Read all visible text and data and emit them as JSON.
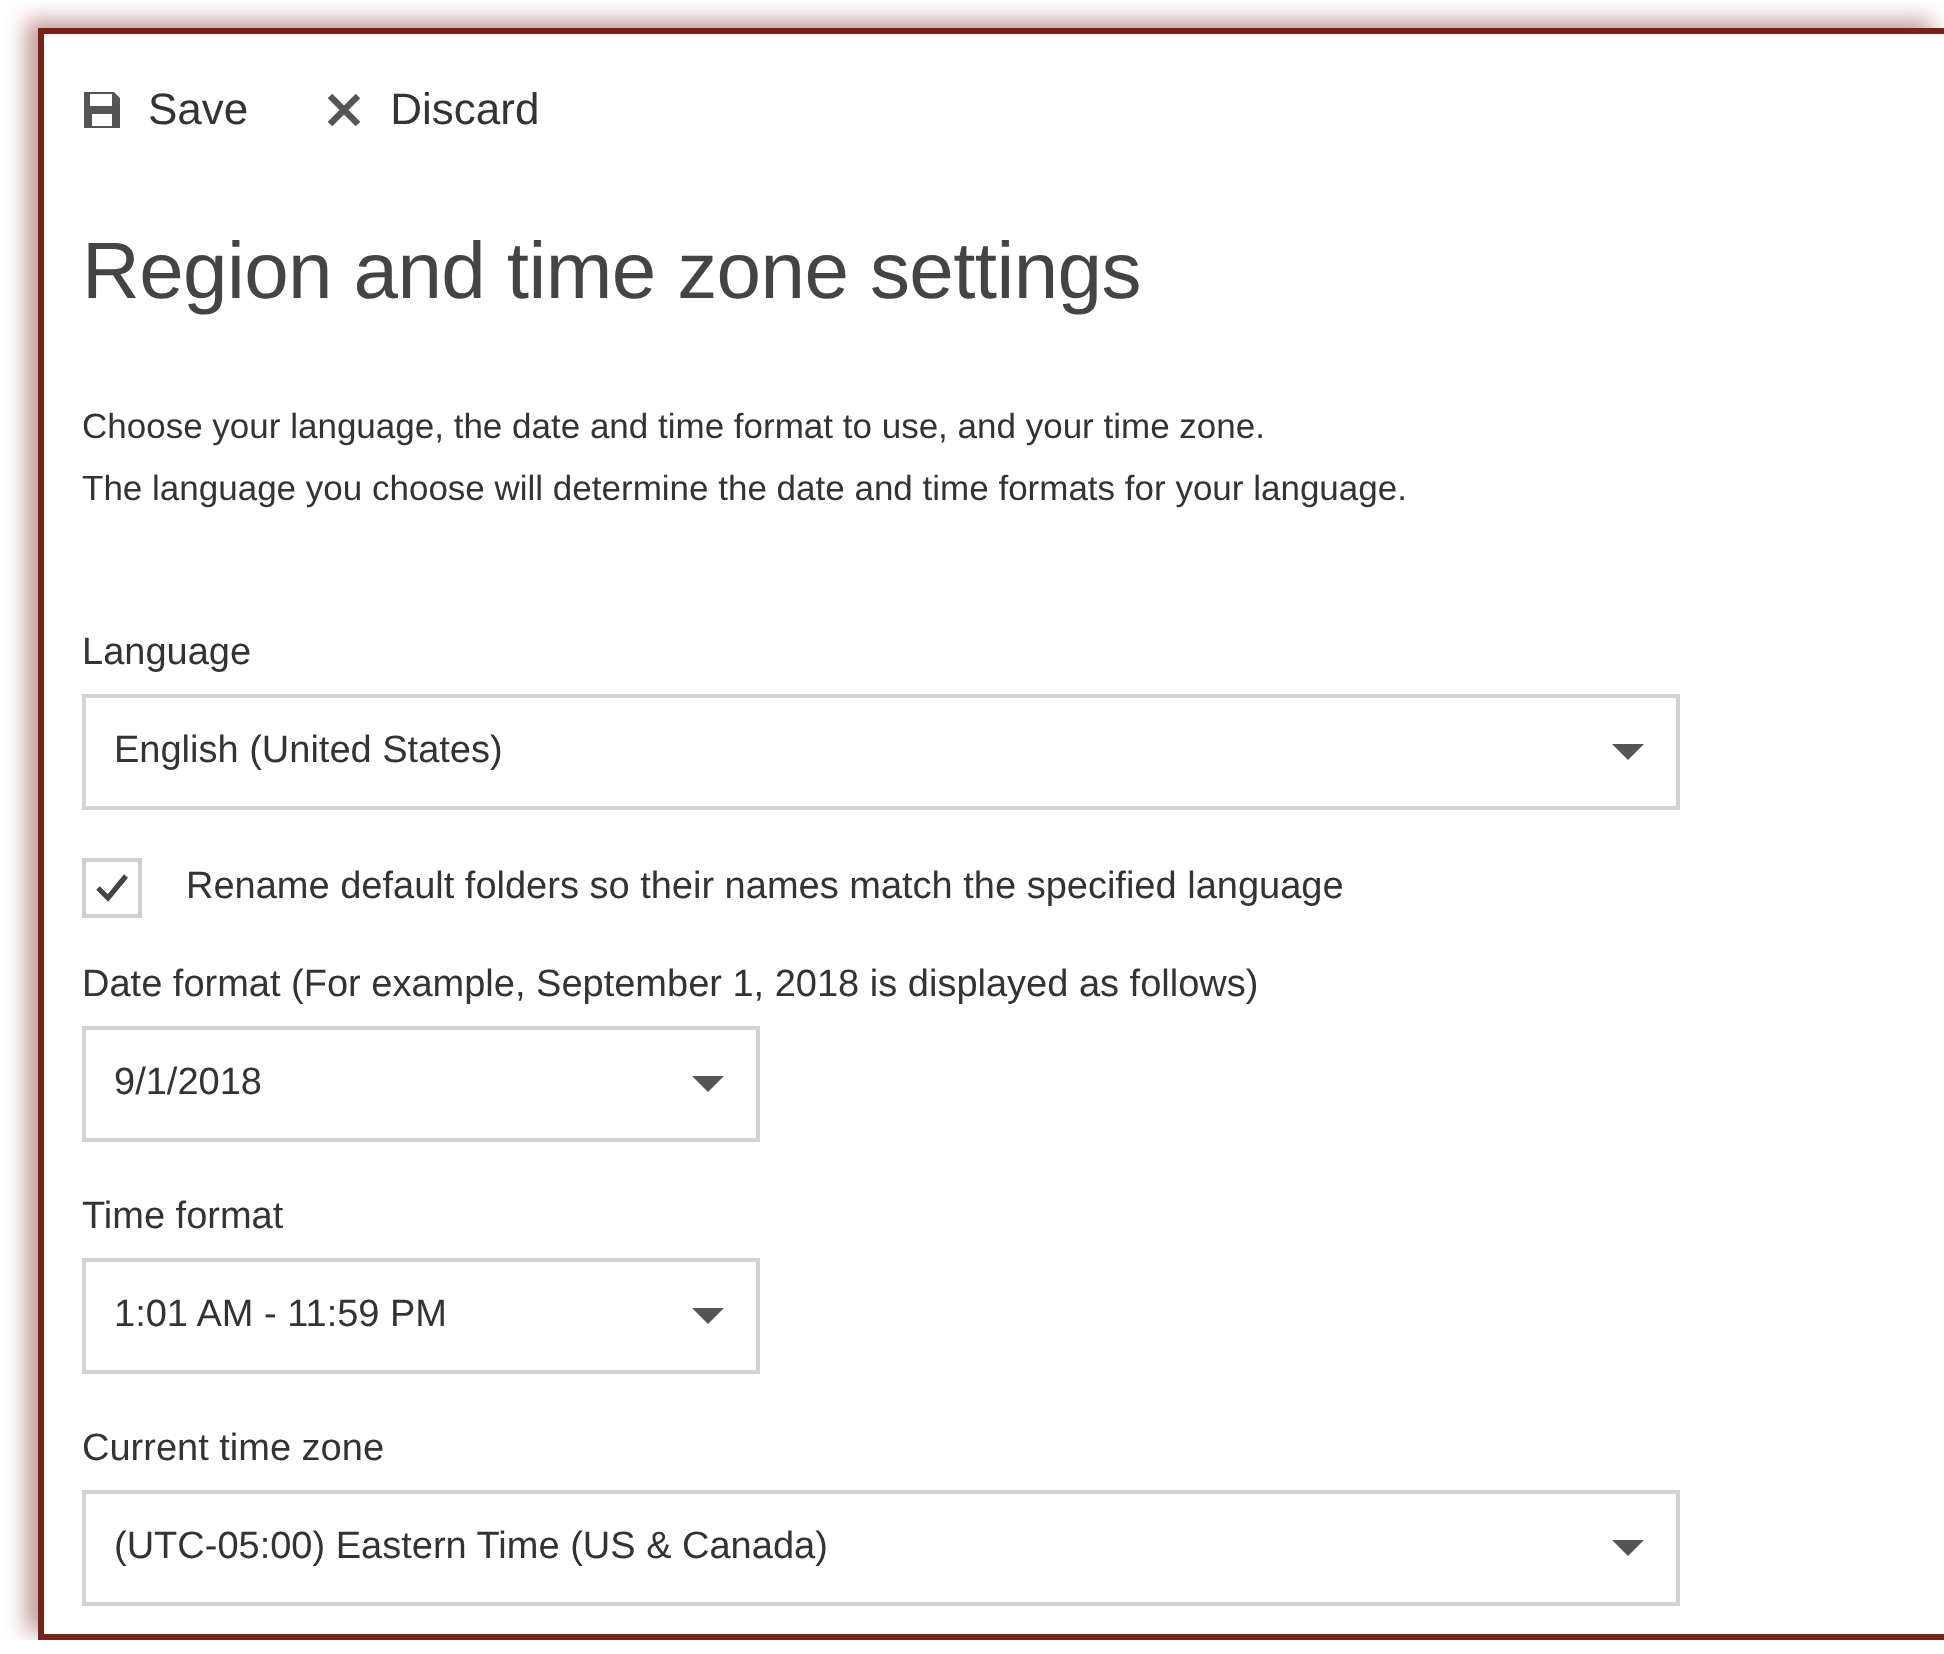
{
  "toolbar": [
    {
      "kind": "save",
      "label": "Save"
    },
    {
      "kind": "discard",
      "label": "Discard"
    }
  ],
  "title": "Region and time zone settings",
  "description": [
    "Choose your language, the date and time format to use, and your time zone.",
    "The language you choose will determine the date and time formats for your language."
  ],
  "settings": [
    {
      "kind": "dropdown",
      "label": "Language",
      "value": "English (United States)"
    },
    {
      "kind": "checkbox",
      "label": "Rename default folders so their names match the specified language",
      "checked": true
    },
    {
      "kind": "dropdown",
      "label": "Date format (For example, September 1, 2018 is displayed as follows)",
      "value": "9/1/2018"
    },
    {
      "kind": "dropdown",
      "label": "Time format",
      "value": "1:01 AM - 11:59 PM"
    },
    {
      "kind": "dropdown",
      "label": "Current time zone",
      "value": "(UTC-05:00) Eastern Time (US & Canada)"
    }
  ]
}
